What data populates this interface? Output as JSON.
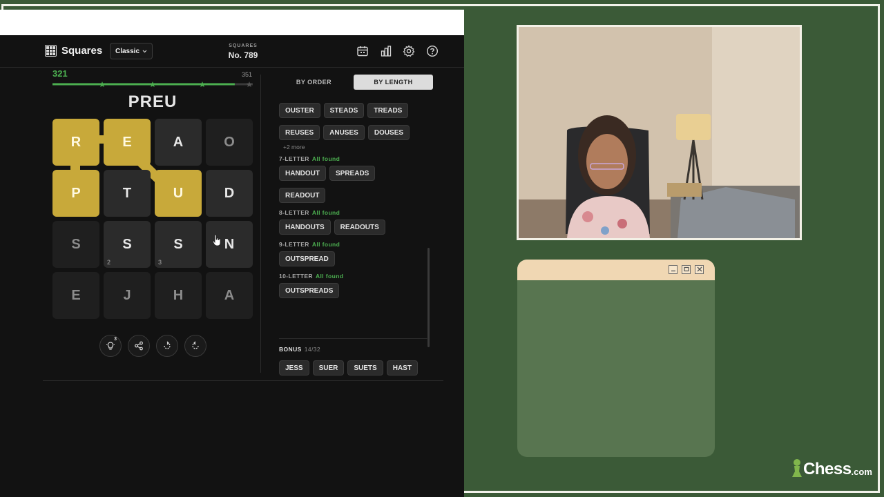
{
  "app": {
    "name": "Squares",
    "mode": "Classic",
    "puzzle_label": "SQUARES",
    "puzzle_number": "No. 789"
  },
  "toolbar_icons": [
    "calendar-icon",
    "stats-icon",
    "settings-icon",
    "help-icon"
  ],
  "progress": {
    "score": "321",
    "max": "351",
    "fraction": 0.91
  },
  "current_word": "PREU",
  "board": [
    {
      "letter": "R",
      "state": "selected",
      "count": ""
    },
    {
      "letter": "E",
      "state": "selected",
      "count": ""
    },
    {
      "letter": "A",
      "state": "normal",
      "count": ""
    },
    {
      "letter": "O",
      "state": "dim",
      "count": ""
    },
    {
      "letter": "P",
      "state": "selected",
      "count": ""
    },
    {
      "letter": "T",
      "state": "normal",
      "count": ""
    },
    {
      "letter": "U",
      "state": "selected",
      "count": ""
    },
    {
      "letter": "D",
      "state": "normal",
      "count": ""
    },
    {
      "letter": "S",
      "state": "dim",
      "count": ""
    },
    {
      "letter": "S",
      "state": "normal",
      "count": "2"
    },
    {
      "letter": "S",
      "state": "normal",
      "count": "3"
    },
    {
      "letter": "N",
      "state": "normal",
      "count": ""
    },
    {
      "letter": "E",
      "state": "dim",
      "count": ""
    },
    {
      "letter": "J",
      "state": "dim",
      "count": ""
    },
    {
      "letter": "H",
      "state": "dim",
      "count": ""
    },
    {
      "letter": "A",
      "state": "dim",
      "count": ""
    }
  ],
  "tools": {
    "hint_count": "3"
  },
  "tabs": {
    "by_order": "BY ORDER",
    "by_length": "BY LENGTH",
    "active": "by_length"
  },
  "six_letter": {
    "rows": [
      [
        "OUSTER",
        "STEADS",
        "TREADS"
      ],
      [
        "REUSES",
        "ANUSES",
        "DOUSES"
      ]
    ],
    "more": "+2 more"
  },
  "groups": [
    {
      "label": "7-LETTER",
      "status": "All found",
      "rows": [
        [
          "HANDOUT",
          "SPREADS"
        ],
        [
          "READOUT"
        ]
      ]
    },
    {
      "label": "8-LETTER",
      "status": "All found",
      "rows": [
        [
          "HANDOUTS",
          "READOUTS"
        ]
      ]
    },
    {
      "label": "9-LETTER",
      "status": "All found",
      "rows": [
        [
          "OUTSPREAD"
        ]
      ]
    },
    {
      "label": "10-LETTER",
      "status": "All found",
      "rows": [
        [
          "OUTSPREADS"
        ]
      ]
    }
  ],
  "bonus": {
    "label": "BONUS",
    "count": "14/32",
    "words": [
      "JESS",
      "SUER",
      "SUETS",
      "HAST"
    ]
  },
  "brand": {
    "name": "Chess",
    "tld": ".com"
  },
  "colors": {
    "accent_green": "#4caf50",
    "selected_tile": "#c8a93a",
    "backdrop": "#3b5a37"
  }
}
